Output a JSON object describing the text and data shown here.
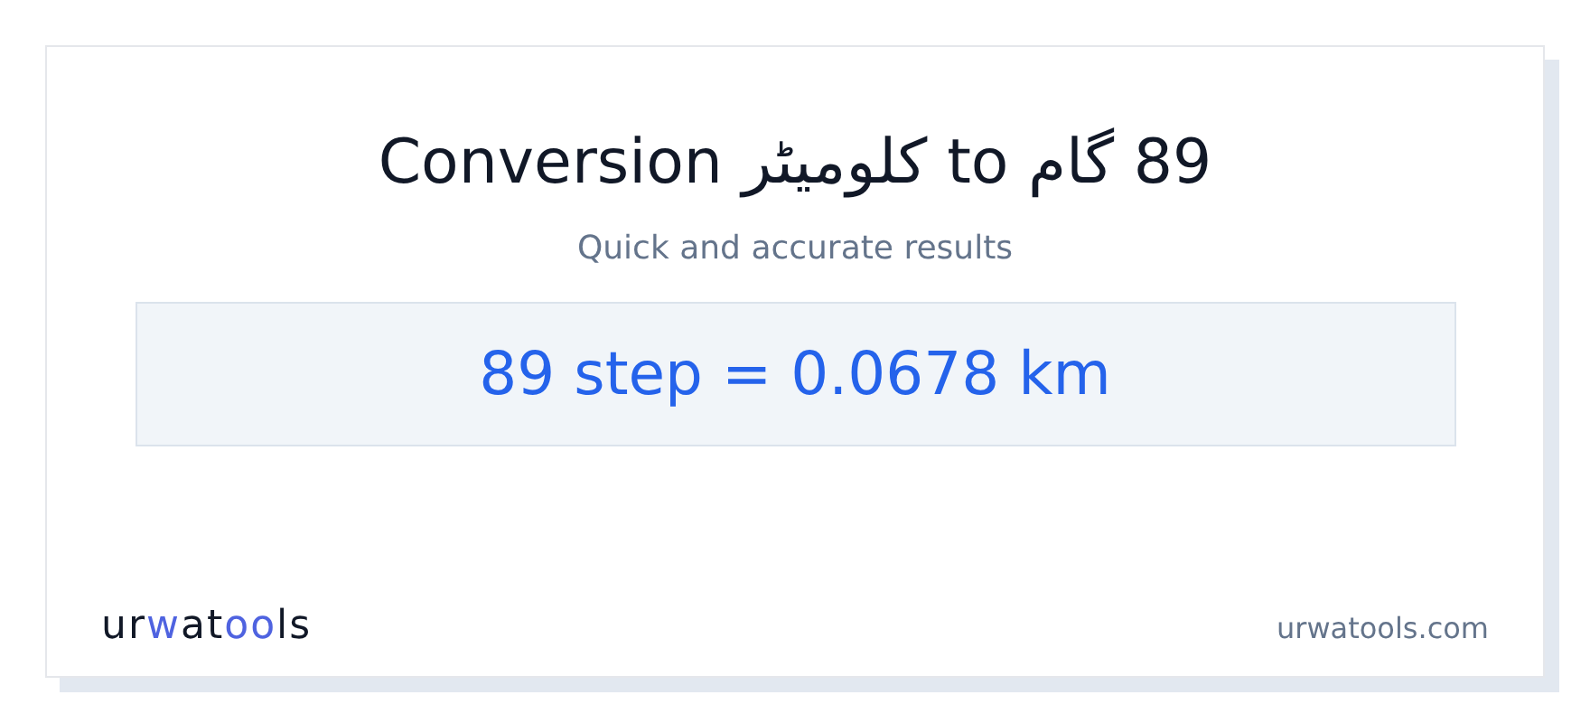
{
  "title": "89 گام to کلومیٹر Conversion",
  "subtitle": "Quick and accurate results",
  "result": "89 step = 0.0678 km",
  "logo": [
    {
      "text": "ur",
      "accent": false
    },
    {
      "text": "w",
      "accent": true
    },
    {
      "text": "at",
      "accent": false
    },
    {
      "text": "oo",
      "accent": true
    },
    {
      "text": "ls",
      "accent": false
    }
  ],
  "site": "urwatools.com"
}
